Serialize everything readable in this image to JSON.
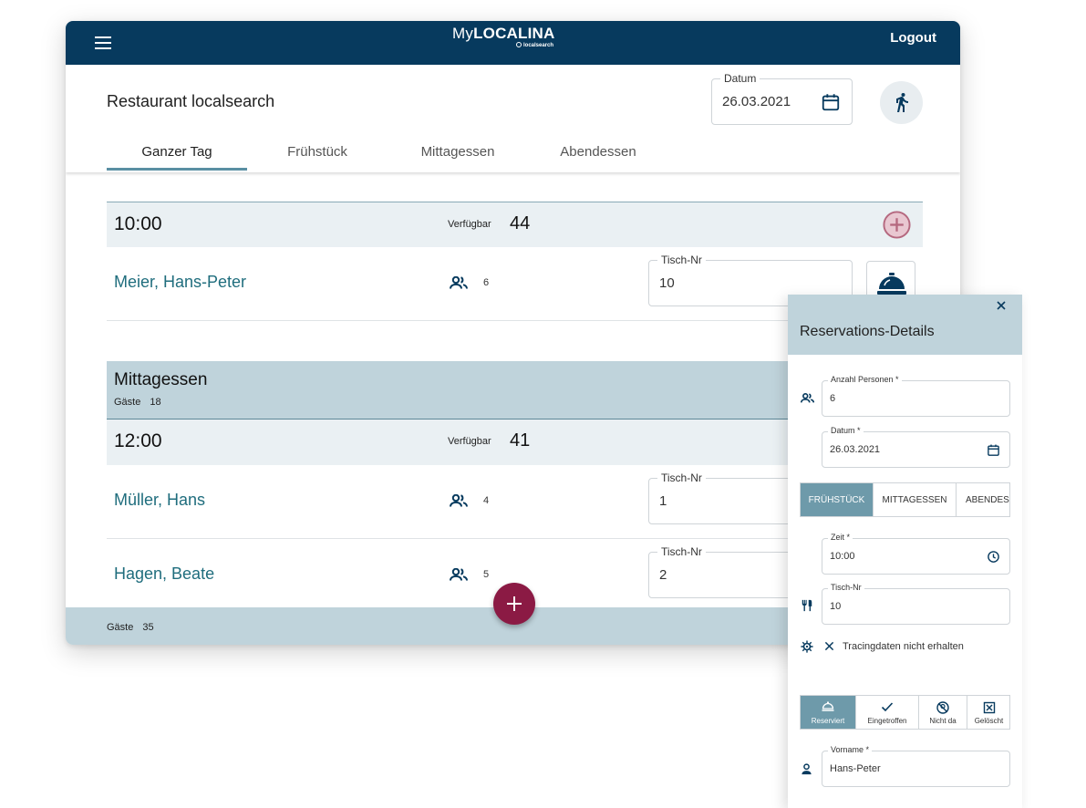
{
  "app": {
    "logo": {
      "my": "My",
      "brand": "LOCALINA",
      "sub": "localsearch"
    },
    "logout_label": "Logout",
    "restaurant_title": "Restaurant localsearch",
    "date_field": {
      "label": "Datum",
      "value": "26.03.2021"
    },
    "tabs": [
      {
        "label": "Ganzer Tag",
        "active": true
      },
      {
        "label": "Frühstück",
        "active": false
      },
      {
        "label": "Mittagessen",
        "active": false
      },
      {
        "label": "Abendessen",
        "active": false
      }
    ],
    "slots": [
      {
        "time": "10:00",
        "available_label": "Verfügbar",
        "available": "44",
        "reservations": [
          {
            "name": "Meier, Hans-Peter",
            "persons": "6",
            "table_label": "Tisch-Nr",
            "table": "10"
          }
        ]
      }
    ],
    "section": {
      "title": "Mittagessen",
      "guests_label": "Gäste",
      "guests": "18",
      "slot": {
        "time": "12:00",
        "available_label": "Verfügbar",
        "available": "41",
        "reservations": [
          {
            "name": "Müller, Hans",
            "persons": "4",
            "table_label": "Tisch-Nr",
            "table": "1"
          },
          {
            "name": "Hagen, Beate",
            "persons": "5",
            "table_label": "Tisch-Nr",
            "table": "2"
          }
        ]
      }
    },
    "footer": {
      "guests_label": "Gäste",
      "guests": "35"
    }
  },
  "panel": {
    "title": "Reservations-Details",
    "persons": {
      "label": "Anzahl Personen *",
      "value": "6"
    },
    "date": {
      "label": "Datum *",
      "value": "26.03.2021"
    },
    "meal_tabs": [
      {
        "label": "FRÜHSTÜCK",
        "active": true
      },
      {
        "label": "MITTAGESSEN",
        "active": false
      },
      {
        "label": "ABENDESSEN",
        "active": false
      }
    ],
    "time": {
      "label": "Zeit *",
      "value": "10:00"
    },
    "table": {
      "label": "Tisch-Nr",
      "value": "10"
    },
    "tracing_text": "Tracingdaten nicht erhalten",
    "status_buttons": [
      {
        "label": "Reserviert",
        "icon": "bell-icon",
        "active": true
      },
      {
        "label": "Eingetroffen",
        "icon": "check-icon",
        "active": false
      },
      {
        "label": "Nicht da",
        "icon": "no-show-icon",
        "active": false
      },
      {
        "label": "Gelöscht",
        "icon": "delete-box-icon",
        "active": false
      }
    ],
    "firstname": {
      "label": "Vorname *",
      "value": "Hans-Peter"
    }
  },
  "colors": {
    "topbar": "#073a5e",
    "accent": "#5a8fa3",
    "section": "#bfd3db",
    "name_link": "#1f6d7d",
    "fab": "#8b1a44",
    "active_toggle": "#6e9aaa"
  }
}
